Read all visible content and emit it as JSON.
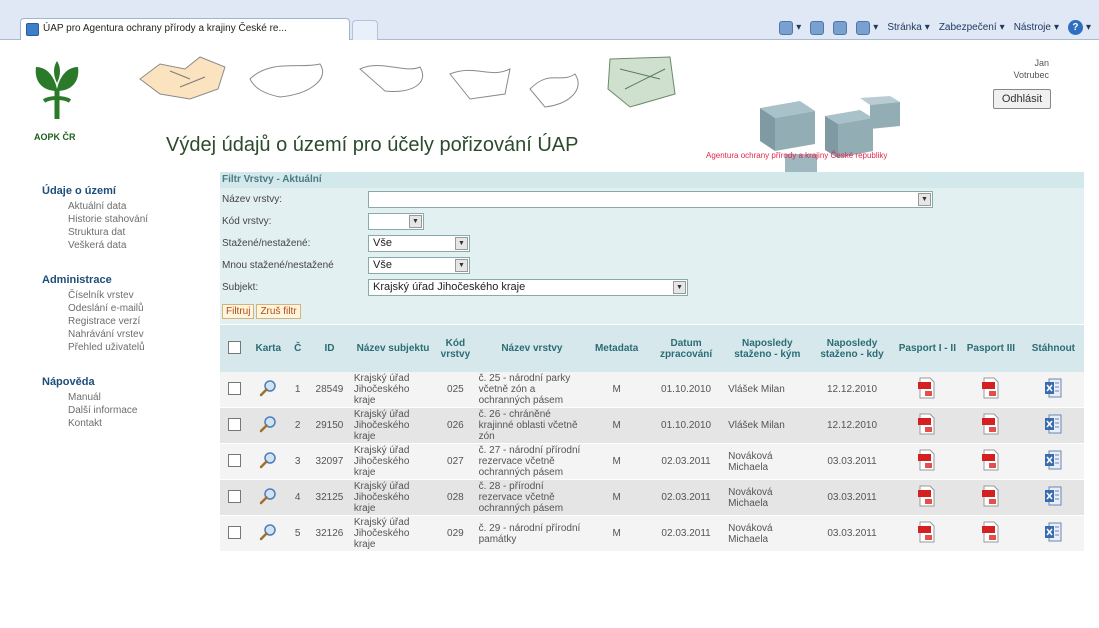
{
  "browser": {
    "tab_title": "ÚAP pro Agentura ochrany přírody a krajiny České re...",
    "toolbar": {
      "page": "Stránka",
      "security": "Zabezpečení",
      "tools": "Nástroje"
    }
  },
  "header": {
    "logo_text": "AOPK ČR",
    "title": "Výdej údajů o území pro účely pořizování ÚAP",
    "agency": "Agentura ochrany přírody a krajiny České republiky",
    "user_first": "Jan",
    "user_last": "Votrubec",
    "logout": "Odhlásit"
  },
  "sidebar": {
    "sections": [
      {
        "title": "Údaje o území",
        "items": [
          "Aktuální data",
          "Historie stahování",
          "Struktura dat",
          "Veškerá data"
        ]
      },
      {
        "title": "Administrace",
        "items": [
          "Číselník vrstev",
          "Odeslání e-mailů",
          "Registrace verzí",
          "Nahrávání vrstev",
          "Přehled uživatelů"
        ]
      },
      {
        "title": "Nápověda",
        "items": [
          "Manuál",
          "Další informace",
          "Kontakt"
        ]
      }
    ]
  },
  "filter": {
    "heading": "Filtr Vrstvy - Aktuální",
    "layer_name_label": "Název vrstvy:",
    "layer_name_value": "",
    "layer_code_label": "Kód vrstvy:",
    "layer_code_value": "",
    "downloaded_label": "Stažené/nestažené:",
    "downloaded_value": "Vše",
    "my_downloaded_label": "Mnou stažené/nestažené",
    "my_downloaded_value": "Vše",
    "subject_label": "Subjekt:",
    "subject_value": "Krajský úřad Jihočeského kraje",
    "filter_button": "Filtruj",
    "cancel_button": "Zruš filtr"
  },
  "table": {
    "headers": [
      "",
      "Karta",
      "Č",
      "ID",
      "Název subjektu",
      "Kód vrstvy",
      "Název vrstvy",
      "Metadata",
      "Datum zpracování",
      "Naposledy staženo - kým",
      "Naposledy staženo - kdy",
      "Pasport I - II",
      "Pasport III",
      "Stáhnout"
    ],
    "rows": [
      {
        "num": "1",
        "id": "28549",
        "subject": "Krajský úřad Jihočeského kraje",
        "code": "025",
        "layer": "č. 25 - národní parky včetně zón a ochranných pásem",
        "meta": "M",
        "date": "01.10.2010",
        "by": "Vlášek Milan",
        "when": "12.12.2010"
      },
      {
        "num": "2",
        "id": "29150",
        "subject": "Krajský úřad Jihočeského kraje",
        "code": "026",
        "layer": "č. 26 - chráněné krajinné oblasti včetně zón",
        "meta": "M",
        "date": "01.10.2010",
        "by": "Vlášek Milan",
        "when": "12.12.2010"
      },
      {
        "num": "3",
        "id": "32097",
        "subject": "Krajský úřad Jihočeského kraje",
        "code": "027",
        "layer": "č. 27 - národní přírodní rezervace včetně ochranných pásem",
        "meta": "M",
        "date": "02.03.2011",
        "by": "Nováková Michaela",
        "when": "03.03.2011"
      },
      {
        "num": "4",
        "id": "32125",
        "subject": "Krajský úřad Jihočeského kraje",
        "code": "028",
        "layer": "č. 28 - přírodní rezervace včetně ochranných pásem",
        "meta": "M",
        "date": "02.03.2011",
        "by": "Nováková Michaela",
        "when": "03.03.2011"
      },
      {
        "num": "5",
        "id": "32126",
        "subject": "Krajský úřad Jihočeského kraje",
        "code": "029",
        "layer": "č. 29 - národní přírodní památky",
        "meta": "M",
        "date": "02.03.2011",
        "by": "Nováková Michaela",
        "when": "03.03.2011"
      }
    ]
  },
  "colors": {
    "filter_bg": "#e3f0f2",
    "header_bg": "#d6e8eb",
    "accent_red": "#e0284a",
    "title_green": "#2c4b2c"
  }
}
